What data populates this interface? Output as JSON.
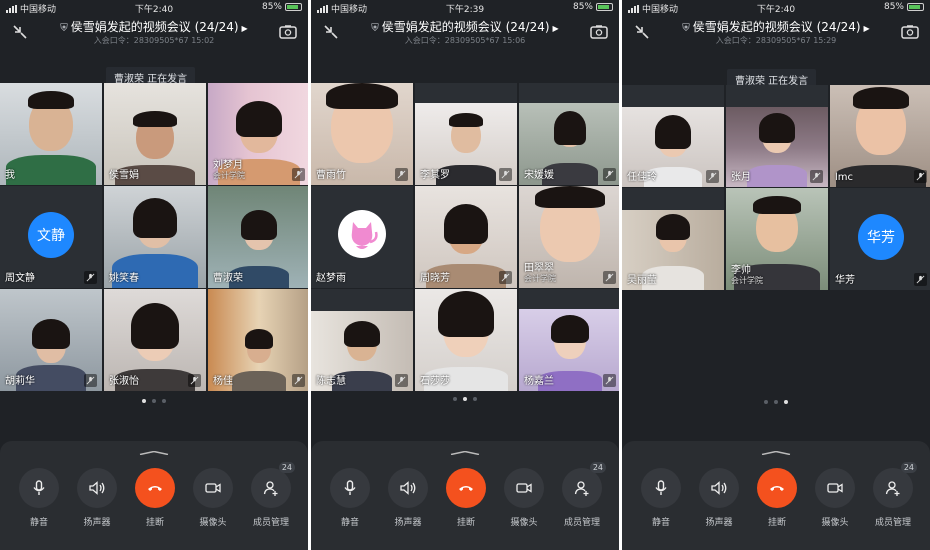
{
  "screens": [
    {
      "status": {
        "carrier": "中国移动",
        "time": "下午2:40",
        "battery": "85%"
      },
      "title": "侯雪娟发起的视频会议 (24/24)",
      "meeting_id": "入会口令：28309505*67 15:02",
      "speaking": "曹淑荣 正在发言",
      "participants": [
        "我",
        "侯雪娟",
        "刘梦月",
        "周文静",
        "姚笑春",
        "曹淑荣",
        "胡莉华",
        "张淑怡",
        "杨佳"
      ],
      "avatar_text": "文静",
      "sub_labels": {
        "2": "会计学院"
      },
      "page": 0
    },
    {
      "status": {
        "carrier": "中国移动",
        "time": "下午2:39",
        "battery": "85%"
      },
      "title": "侯雪娟发起的视频会议 (24/24)",
      "meeting_id": "入会口令：28309505*67 15:06",
      "participants": [
        "曹雨竹",
        "李其罗",
        "宋媛媛",
        "赵梦雨",
        "周晓芳",
        "田翠翠",
        "陈志慧",
        "石莎莎",
        "杨嘉兰"
      ],
      "sub_labels": {
        "5": "会计学院"
      },
      "page": 1
    },
    {
      "status": {
        "carrier": "中国移动",
        "time": "下午2:40",
        "battery": "85%"
      },
      "title": "侯雪娟发起的视频会议 (24/24)",
      "meeting_id": "入会口令：28309505*67 15:29",
      "speaking": "曹淑荣 正在发言",
      "participants": [
        "任佳玲",
        "张月",
        "lmc",
        "吴丽莹",
        "李帅",
        "华芳"
      ],
      "avatar_text": "华芳",
      "sub_labels": {
        "4": "会计学院"
      },
      "page": 2
    }
  ],
  "controls": {
    "mute": "静音",
    "speaker": "扬声器",
    "hangup": "挂断",
    "camera": "摄像头",
    "members": "成员管理",
    "members_count": "24"
  },
  "colors": {
    "background": "#1f2226",
    "panel": "#2a2d31",
    "hangup": "#f4511e",
    "avatar": "#1e88ff",
    "active_speaker": "#2fae5b"
  },
  "icons": [
    "signal-icon",
    "wifi-icon",
    "battery-icon",
    "shield-icon",
    "minimize-icon",
    "switch-camera-icon",
    "mic-icon",
    "speaker-icon",
    "hangup-icon",
    "camera-icon",
    "add-member-icon",
    "pink-cat-avatar-icon"
  ]
}
